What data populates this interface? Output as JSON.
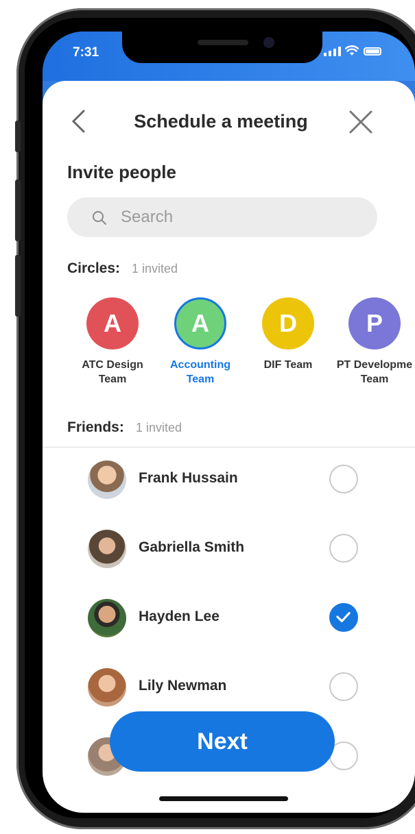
{
  "status_bar": {
    "time": "7:31"
  },
  "header": {
    "title": "Schedule a meeting"
  },
  "invite": {
    "heading": "Invite people"
  },
  "search": {
    "placeholder": "Search"
  },
  "circles": {
    "label": "Circles:",
    "invited_count": "1 invited",
    "items": [
      {
        "initial": "A",
        "name_line1": "ATC Design",
        "name_line2": "Team",
        "color": "#e05258",
        "selected": false
      },
      {
        "initial": "A",
        "name_line1": "Accounting",
        "name_line2": "Team",
        "color": "#6fd17a",
        "selected": true
      },
      {
        "initial": "D",
        "name_line1": "DIF Team",
        "name_line2": "",
        "color": "#ecc40a",
        "selected": false
      },
      {
        "initial": "P",
        "name_line1": "PT Developme",
        "name_line2": "Team",
        "color": "#7a77d8",
        "selected": false
      }
    ]
  },
  "friends": {
    "label": "Friends:",
    "invited_count": "1 invited",
    "items": [
      {
        "name": "Frank Hussain",
        "checked": false,
        "avatar_color": "#8a6b52"
      },
      {
        "name": "Gabriella Smith",
        "checked": false,
        "avatar_color": "#6b5a4a"
      },
      {
        "name": "Hayden Lee",
        "checked": true,
        "avatar_color": "#4e6b3c"
      },
      {
        "name": "Lily Newman",
        "checked": false,
        "avatar_color": "#b07a5a"
      },
      {
        "name": "",
        "checked": false,
        "avatar_color": "#9a8070"
      }
    ]
  },
  "actions": {
    "next_label": "Next"
  },
  "colors": {
    "primary": "#1677e0",
    "status_gradient_start": "#1f6fe0",
    "status_gradient_end": "#3f8ff0"
  }
}
